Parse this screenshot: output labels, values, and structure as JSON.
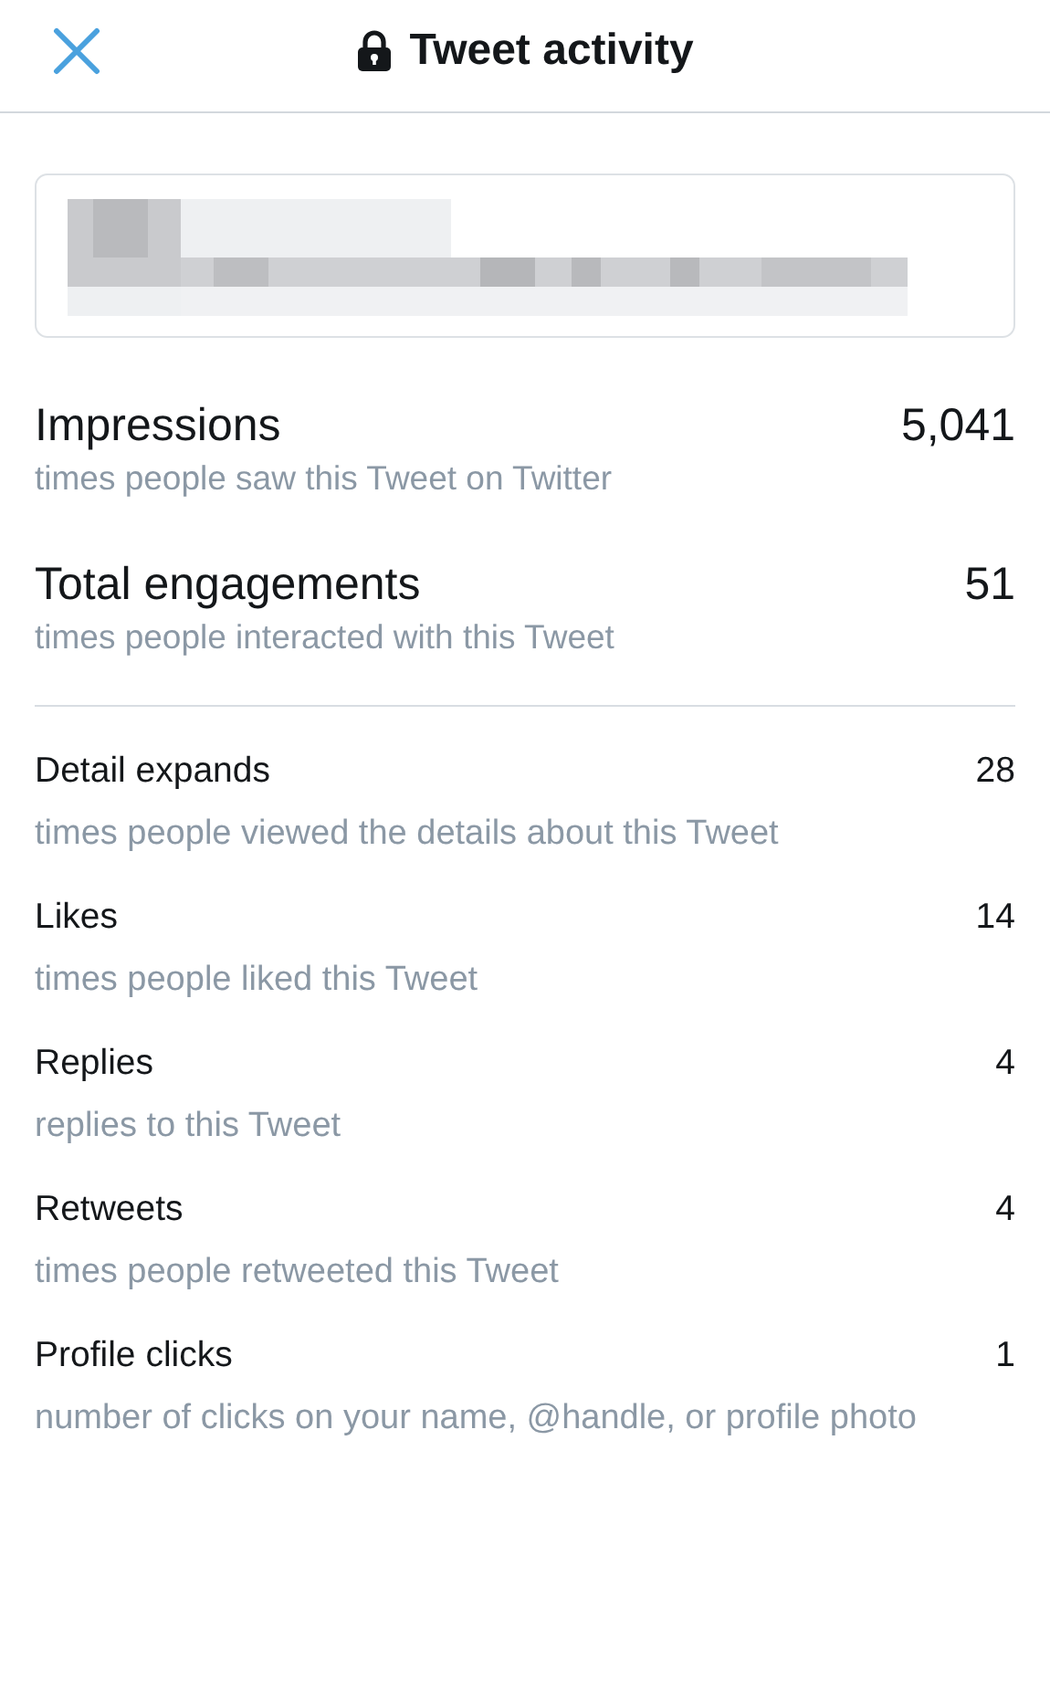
{
  "header": {
    "title": "Tweet activity"
  },
  "metrics": [
    {
      "kind": "major",
      "label": "Impressions",
      "value": "5,041",
      "description": "times people saw this Tweet on Twitter"
    },
    {
      "kind": "major",
      "label": "Total engagements",
      "value": "51",
      "description": "times people interacted with this Tweet"
    },
    {
      "kind": "minor",
      "label": "Detail expands",
      "value": "28",
      "description": "times people viewed the details about this Tweet"
    },
    {
      "kind": "minor",
      "label": "Likes",
      "value": "14",
      "description": "times people liked this Tweet"
    },
    {
      "kind": "minor",
      "label": "Replies",
      "value": "4",
      "description": "replies to this Tweet"
    },
    {
      "kind": "minor",
      "label": "Retweets",
      "value": "4",
      "description": "times people retweeted this Tweet"
    },
    {
      "kind": "minor",
      "label": "Profile clicks",
      "value": "1",
      "description": "number of clicks on your name, @handle, or profile photo"
    }
  ]
}
